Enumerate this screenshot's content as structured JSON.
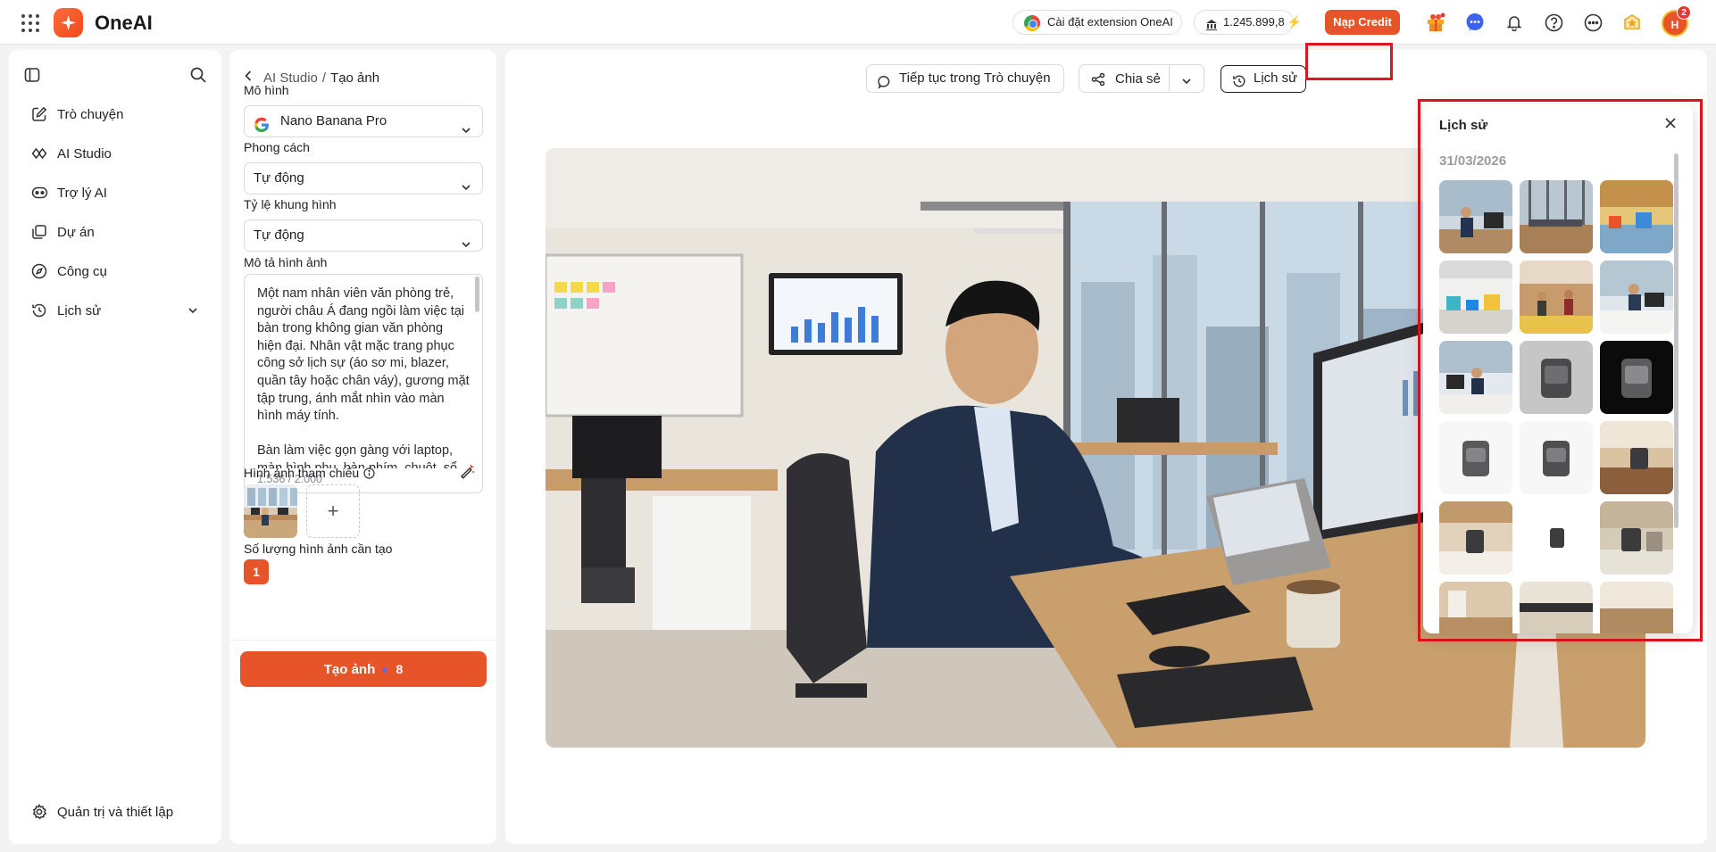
{
  "app": {
    "name": "OneAI"
  },
  "topbar": {
    "extension_label": "Cài đặt extension OneAI",
    "credit_balance": "1.245.899,8",
    "topup_label": "Nạp Credit",
    "avatar_initials": "H",
    "notification_count": "2",
    "icons": [
      "apps-grid-icon",
      "gift-icon",
      "messenger-icon",
      "bell-icon",
      "help-icon",
      "more-icon",
      "reward-icon"
    ]
  },
  "sidebar": {
    "items": [
      {
        "label": "Trò chuyện",
        "icon": "edit-chat-icon"
      },
      {
        "label": "AI Studio",
        "icon": "ai-studio-icon"
      },
      {
        "label": "Trợ lý AI",
        "icon": "assistant-icon"
      },
      {
        "label": "Dự án",
        "icon": "folder-icon"
      },
      {
        "label": "Công cụ",
        "icon": "compass-icon"
      },
      {
        "label": "Lịch sử",
        "icon": "history-icon"
      }
    ],
    "settings_label": "Quản trị và thiết lập"
  },
  "form": {
    "breadcrumb": {
      "parent": "AI Studio",
      "separator": "/",
      "current": "Tạo ảnh"
    },
    "model_label": "Mô hình",
    "model_value": "Nano Banana Pro",
    "style_label": "Phong cách",
    "style_value": "Tự động",
    "ratio_label": "Tỷ lệ khung hình",
    "ratio_value": "Tự động",
    "prompt_label": "Mô tả hình ảnh",
    "prompt_text": "Một nam nhân viên văn phòng trẻ, người châu Á đang ngồi làm việc tại bàn trong không gian văn phòng hiện đại. Nhân vật mặc trang phục công sở lịch sự (áo sơ mi, blazer, quần tây hoặc chân váy), gương mặt tập trung, ánh mắt nhìn vào màn hình máy tính.\n\nBàn làm việc gọn gàng với laptop, màn hình phụ, bàn phím, chuột, sổ",
    "prompt_count": "1.536 / 2.000",
    "ref_label": "Hình ảnh tham chiếu",
    "ref_add": "+",
    "qty_label": "Số lượng hình ảnh cần tạo",
    "qty_value": "1",
    "generate_label": "Tạo ảnh",
    "generate_cost": "8"
  },
  "main": {
    "continue_chat_label": "Tiếp tục trong Trò chuyện",
    "share_label": "Chia sẻ",
    "history_label": "Lịch sử"
  },
  "history_panel": {
    "title": "Lịch sử",
    "date": "31/03/2026",
    "thumbnails": [
      "office-man-desk",
      "office-wide-window",
      "office-colorful",
      "office-open-space",
      "office-people",
      "office-man-laptop",
      "office-man-desk-2",
      "air-fryer-grey",
      "air-fryer-black",
      "air-fryer-white-1",
      "air-fryer-white-2",
      "kitchen-air-fryer",
      "kitchen-counter",
      "air-fryer-small",
      "kitchen-air-fryer-2",
      "kitchen-top-1",
      "kitchen-top-2",
      "kitchen-top-3"
    ]
  },
  "colors": {
    "accent": "#e8542a",
    "highlight": "#e0141e"
  }
}
